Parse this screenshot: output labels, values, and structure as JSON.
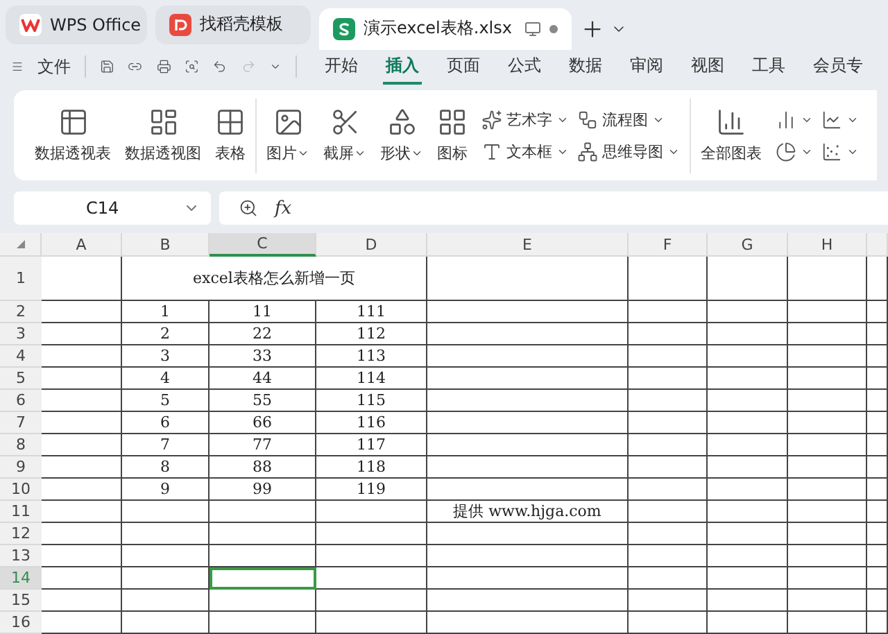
{
  "tabs": [
    {
      "kind": "wps",
      "label": "WPS Office",
      "selected": false
    },
    {
      "kind": "template",
      "label": "找稻壳模板",
      "selected": false
    },
    {
      "kind": "sheet",
      "label": "演示excel表格.xlsx",
      "selected": true
    }
  ],
  "file_menu": "文件",
  "ribbon_tabs": [
    {
      "label": "开始",
      "selected": false
    },
    {
      "label": "插入",
      "selected": true
    },
    {
      "label": "页面",
      "selected": false
    },
    {
      "label": "公式",
      "selected": false
    },
    {
      "label": "数据",
      "selected": false
    },
    {
      "label": "审阅",
      "selected": false
    },
    {
      "label": "视图",
      "selected": false
    },
    {
      "label": "工具",
      "selected": false
    },
    {
      "label": "会员专",
      "selected": false
    }
  ],
  "ribbon_groups": [
    {
      "large": [
        {
          "label": "数据透视表",
          "dropdown": false
        },
        {
          "label": "数据透视图",
          "dropdown": false
        },
        {
          "label": "表格",
          "dropdown": false
        }
      ]
    },
    {
      "large": [
        {
          "label": "图片",
          "dropdown": true
        },
        {
          "label": "截屏",
          "dropdown": true
        },
        {
          "label": "形状",
          "dropdown": true
        },
        {
          "label": "图标",
          "dropdown": false
        }
      ],
      "small": [
        {
          "label": "艺术字",
          "dropdown": true
        },
        {
          "label": "文本框",
          "dropdown": true
        },
        {
          "label": "流程图",
          "dropdown": true
        },
        {
          "label": "思维导图",
          "dropdown": true
        }
      ]
    },
    {
      "large": [
        {
          "label": "全部图表",
          "dropdown": false
        }
      ],
      "small": [
        {
          "dropdown": true
        },
        {
          "dropdown": true
        },
        {
          "dropdown": true
        },
        {
          "dropdown": true
        }
      ]
    }
  ],
  "name_box": "C14",
  "fx_label": "fx",
  "columns": [
    {
      "label": "A",
      "selected": false
    },
    {
      "label": "B",
      "selected": false
    },
    {
      "label": "C",
      "selected": true
    },
    {
      "label": "D",
      "selected": false
    },
    {
      "label": "E",
      "selected": false
    },
    {
      "label": "F",
      "selected": false
    },
    {
      "label": "G",
      "selected": false
    },
    {
      "label": "H",
      "selected": false
    }
  ],
  "rows": [
    {
      "number": "1",
      "selected": false,
      "cells": {
        "B:D": "excel表格怎么新增一页"
      }
    },
    {
      "number": "2",
      "selected": false,
      "cells": {
        "B": "1",
        "C": "11",
        "D": "111"
      }
    },
    {
      "number": "3",
      "selected": false,
      "cells": {
        "B": "2",
        "C": "22",
        "D": "112"
      }
    },
    {
      "number": "4",
      "selected": false,
      "cells": {
        "B": "3",
        "C": "33",
        "D": "113"
      }
    },
    {
      "number": "5",
      "selected": false,
      "cells": {
        "B": "4",
        "C": "44",
        "D": "114"
      }
    },
    {
      "number": "6",
      "selected": false,
      "cells": {
        "B": "5",
        "C": "55",
        "D": "115"
      }
    },
    {
      "number": "7",
      "selected": false,
      "cells": {
        "B": "6",
        "C": "66",
        "D": "116"
      }
    },
    {
      "number": "8",
      "selected": false,
      "cells": {
        "B": "7",
        "C": "77",
        "D": "117"
      }
    },
    {
      "number": "9",
      "selected": false,
      "cells": {
        "B": "8",
        "C": "88",
        "D": "118"
      }
    },
    {
      "number": "10",
      "selected": false,
      "cells": {
        "B": "9",
        "C": "99",
        "D": "119"
      }
    },
    {
      "number": "11",
      "selected": false,
      "cells": {
        "E": "提供 www.hjga.com"
      }
    },
    {
      "number": "12",
      "selected": false,
      "cells": {}
    },
    {
      "number": "13",
      "selected": false,
      "cells": {}
    },
    {
      "number": "14",
      "selected": true,
      "cells": {}
    },
    {
      "number": "15",
      "selected": false,
      "cells": {}
    },
    {
      "number": "16",
      "selected": false,
      "cells": {}
    }
  ]
}
